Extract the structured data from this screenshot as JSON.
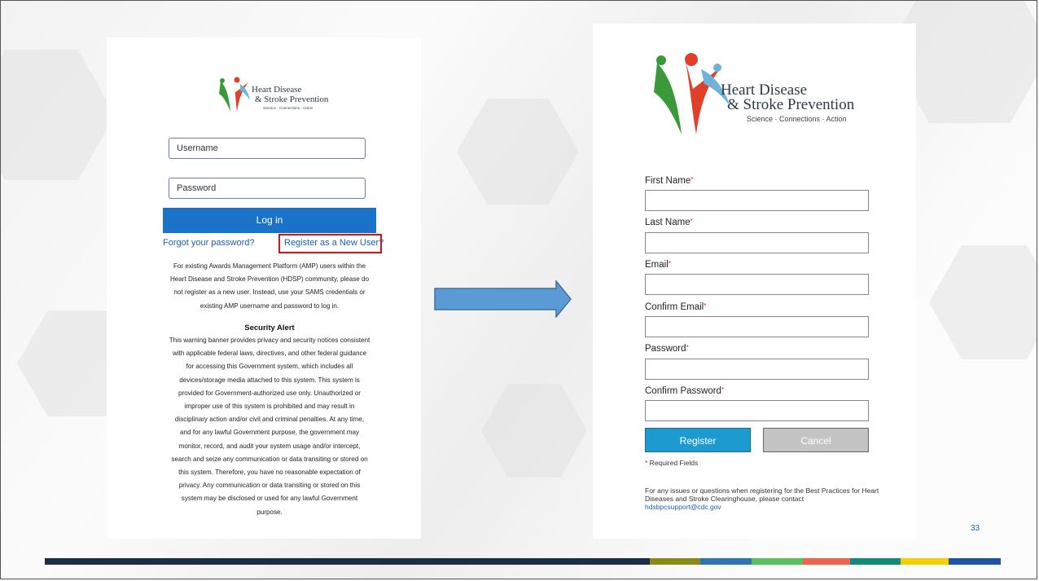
{
  "slide": {
    "page_number": "33"
  },
  "login_panel": {
    "logo": {
      "line1": "Heart Disease",
      "line2": "& Stroke Prevention",
      "tagline": "Science · Connections · Action"
    },
    "username_placeholder": "Username",
    "password_placeholder": "Password",
    "login_label": "Log in",
    "forgot_link": "Forgot your password?",
    "register_link": "Register as a New User?",
    "info_lines": [
      "For existing Awards Management Platform (AMP) users within the",
      "Heart Disease and Stroke Prevention (HDSP) community, please do",
      "not register as a new user. Instead, use your SAMS credentials or",
      "existing AMP username and password to log in."
    ],
    "security_title": "Security Alert",
    "security_lines": [
      "This warning banner provides privacy and security notices consistent",
      "with applicable federal laws, directives, and other federal guidance",
      "for accessing this Government system, which includes all",
      "devices/storage media attached to this system. This system is",
      "provided for Government-authorized use only. Unauthorized or",
      "improper use of this system is prohibited and may result in",
      "disciplinary action and/or civil and criminal penalties. At any time,",
      "and for any lawful Government purpose, the government may",
      "monitor, record, and audit your system usage and/or intercept,",
      "search and seize any communication or data transiting or stored on",
      "this system. Therefore, you have no reasonable expectation of",
      "privacy. Any communication or data transiting or stored on this",
      "system may be disclosed or used for any lawful Government",
      "purpose."
    ]
  },
  "register_panel": {
    "logo": {
      "line1": "Heart Disease",
      "line2": "& Stroke Prevention",
      "tagline": "Science · Connections · Action"
    },
    "fields": [
      {
        "label": "First Name",
        "required": "*"
      },
      {
        "label": "Last Name",
        "required": "*"
      },
      {
        "label": "Email",
        "required": "*"
      },
      {
        "label": "Confirm Email",
        "required": "*"
      },
      {
        "label": "Password",
        "required": "*"
      },
      {
        "label": "Confirm Password",
        "required": "*"
      }
    ],
    "register_label": "Register",
    "cancel_label": "Cancel",
    "required_note_star": "*",
    "required_note": " Required Fields",
    "contact_text": "For any issues or questions when registering for the Best Practices for Heart Diseases and Stroke Clearinghouse, please contact ",
    "contact_email": "hdsbpcsupport@cdc.gov"
  },
  "footer_colors": [
    "#1c2d45",
    "#8a8a1a",
    "#2e75b6",
    "#5bbf5b",
    "#ef6450",
    "#138a76",
    "#f5d000",
    "#1f55a3"
  ]
}
